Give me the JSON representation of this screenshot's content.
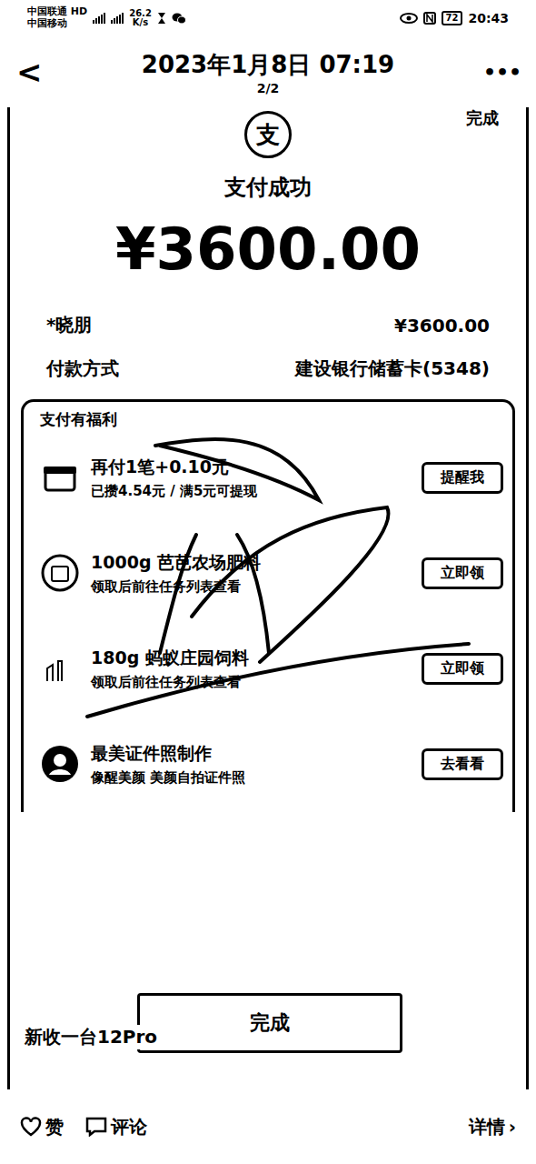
{
  "status_bar": {
    "carrier1": "中国联通",
    "hd": "HD",
    "carrier2": "中国移动",
    "speed": "26.2",
    "speed_unit": "K/s",
    "battery": "72",
    "time": "20:43"
  },
  "header": {
    "back": "<",
    "title": "2023年1月8日 07:19",
    "page": "2/2",
    "more": "•••"
  },
  "receipt": {
    "corner": "完成",
    "logo": "支",
    "status": "支付成功",
    "amount": "¥3600.00",
    "payee": "*晓朋",
    "payee_amount": "¥3600.00",
    "method_label": "付款方式",
    "method": "建设银行储蓄卡(5348)"
  },
  "benefits": {
    "title": "支付有福利",
    "items": [
      {
        "title": "再付1笔+0.10元",
        "subtitle": "已攒4.54元 / 满5元可提现",
        "button": "提醒我"
      },
      {
        "title": "1000g 芭芭农场肥料",
        "subtitle": "领取后前往任务列表查看",
        "button": "立即领"
      },
      {
        "title": "180g 蚂蚁庄园饲料",
        "subtitle": "领取后前往任务列表查看",
        "button": "立即领"
      },
      {
        "title": "最美证件照制作",
        "subtitle": "像醒美颜  美颜自拍证件照",
        "button": "去看看"
      }
    ]
  },
  "done_button": "完成",
  "caption": "新收一台12Pro",
  "footer": {
    "like": "赞",
    "comment": "评论",
    "details": "详情",
    "details_arrow": "›"
  }
}
